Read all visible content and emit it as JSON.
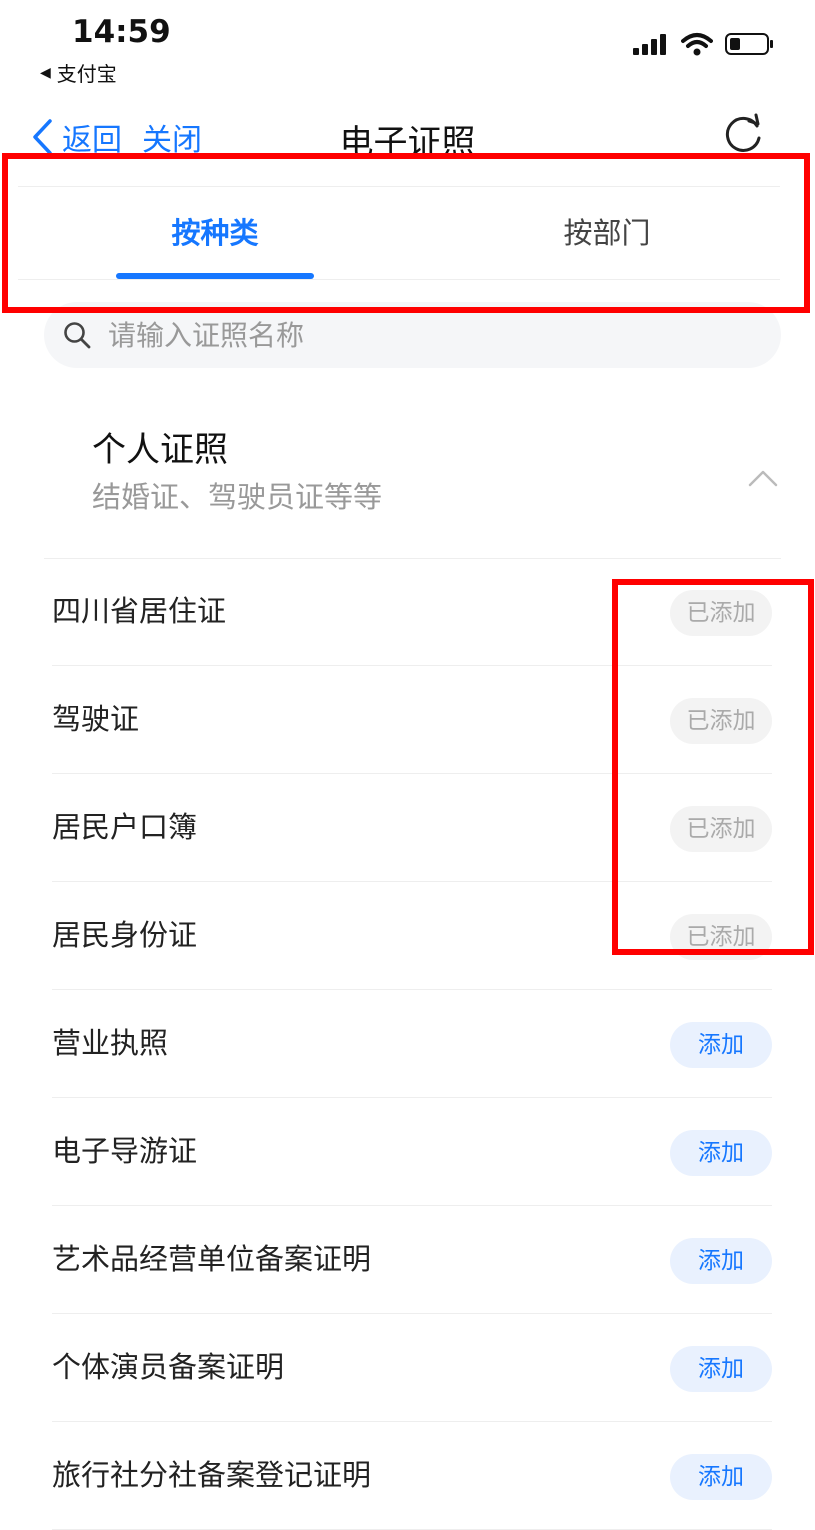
{
  "status": {
    "time": "14:59",
    "back_app": "支付宝"
  },
  "nav": {
    "back": "返回",
    "close": "关闭",
    "title": "电子证照"
  },
  "tabs": [
    {
      "label": "按种类",
      "active": true
    },
    {
      "label": "按部门",
      "active": false
    }
  ],
  "search": {
    "placeholder": "请输入证照名称"
  },
  "section": {
    "title": "个人证照",
    "subtitle": "结婚证、驾驶员证等等"
  },
  "items": [
    {
      "name": "四川省居住证",
      "button": "已添加",
      "added": true
    },
    {
      "name": "驾驶证",
      "button": "已添加",
      "added": true
    },
    {
      "name": "居民户口簿",
      "button": "已添加",
      "added": true
    },
    {
      "name": "居民身份证",
      "button": "已添加",
      "added": true
    },
    {
      "name": "营业执照",
      "button": "添加",
      "added": false
    },
    {
      "name": "电子导游证",
      "button": "添加",
      "added": false
    },
    {
      "name": "艺术品经营单位备案证明",
      "button": "添加",
      "added": false
    },
    {
      "name": "个体演员备案证明",
      "button": "添加",
      "added": false
    },
    {
      "name": "旅行社分社备案登记证明",
      "button": "添加",
      "added": false
    }
  ],
  "colors": {
    "accent": "#1677ff",
    "highlight": "#ff0000",
    "muted": "#999999"
  }
}
